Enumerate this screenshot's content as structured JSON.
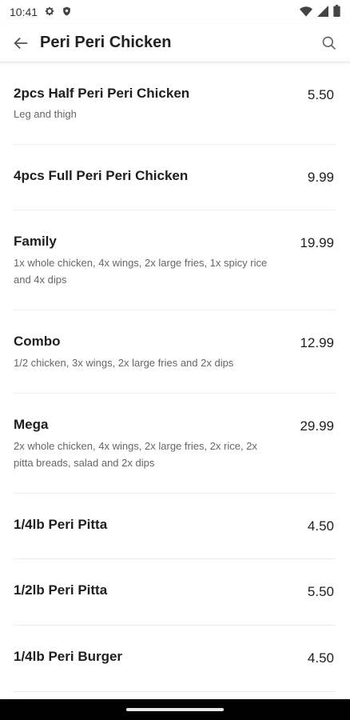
{
  "status": {
    "time": "10:41"
  },
  "header": {
    "title": "Peri Peri Chicken"
  },
  "items": [
    {
      "name": "2pcs Half Peri Peri Chicken",
      "desc": "Leg and thigh",
      "price": "5.50"
    },
    {
      "name": "4pcs Full Peri Peri Chicken",
      "desc": "",
      "price": "9.99"
    },
    {
      "name": "Family",
      "desc": "1x whole chicken, 4x wings, 2x large fries, 1x spicy rice and 4x dips",
      "price": "19.99"
    },
    {
      "name": "Combo",
      "desc": "1/2 chicken, 3x wings, 2x large fries and 2x dips",
      "price": "12.99"
    },
    {
      "name": "Mega",
      "desc": "2x whole chicken, 4x wings, 2x large fries, 2x rice, 2x pitta breads, salad and 2x dips",
      "price": "29.99"
    },
    {
      "name": "1/4lb Peri Pitta",
      "desc": "",
      "price": "4.50"
    },
    {
      "name": "1/2lb Peri Pitta",
      "desc": "",
      "price": "5.50"
    },
    {
      "name": "1/4lb Peri Burger",
      "desc": "",
      "price": "4.50"
    }
  ],
  "icons": {
    "status_left": [
      "settings-icon",
      "shield-icon"
    ],
    "status_right": [
      "wifi-icon",
      "signal-icon",
      "battery-icon"
    ],
    "header": [
      "back-arrow-icon",
      "search-icon"
    ]
  }
}
